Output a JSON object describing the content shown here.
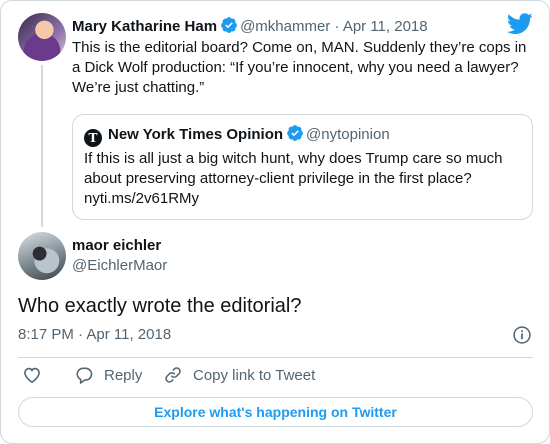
{
  "original_tweet": {
    "name": "Mary Katharine Ham",
    "handle": "@mkhammer",
    "separator": "·",
    "date": "Apr 11, 2018",
    "text": "This is the editorial board? Come on, MAN. Suddenly they’re cops in a Dick Wolf production: “If you’re innocent, why you need a lawyer? We’re just chatting.”"
  },
  "quoted_tweet": {
    "name": "New York Times Opinion",
    "handle": "@nytopinion",
    "logo_glyph": "T",
    "text": "If this is all just a big witch hunt, why does Trump care so much about preserving attorney-client privilege in the first place? nyti.ms/2v61RMy"
  },
  "reply_tweet": {
    "name": "maor eichler",
    "handle": "@EichlerMaor",
    "text": "Who exactly wrote the editorial?",
    "time": "8:17 PM",
    "separator": "·",
    "date": "Apr 11, 2018"
  },
  "actions": {
    "reply_label": "Reply",
    "copy_link_label": "Copy link to Tweet"
  },
  "explore_label": "Explore what's happening on Twitter",
  "colors": {
    "accent": "#1d9bf0",
    "text_primary": "#0f1419",
    "text_secondary": "#536471",
    "border": "#cfd9de"
  }
}
